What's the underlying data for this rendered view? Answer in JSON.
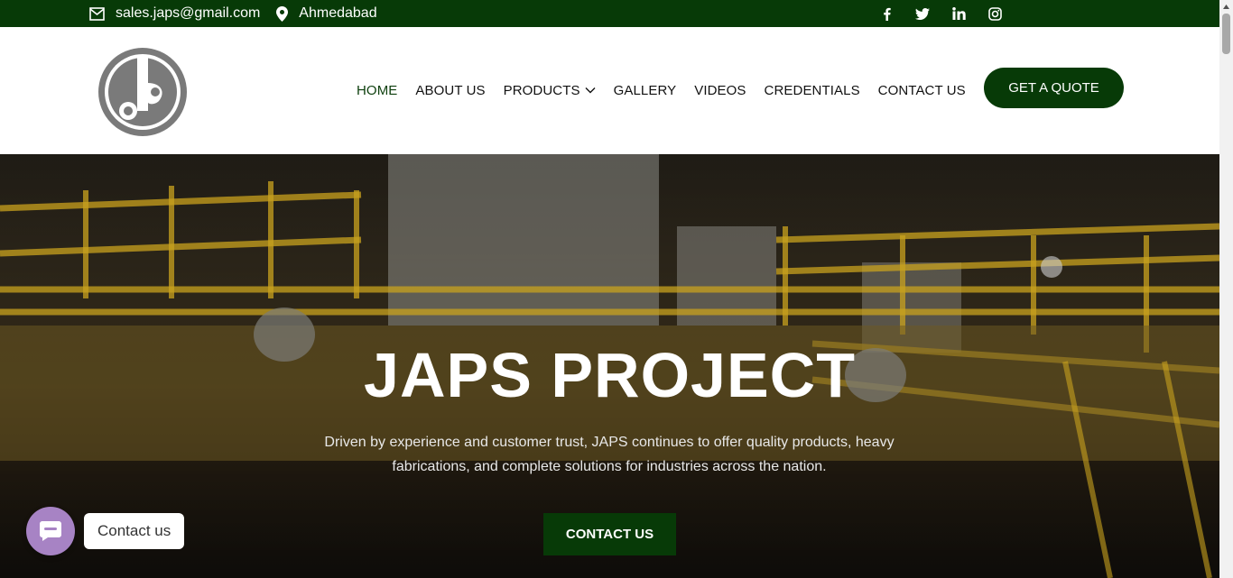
{
  "topbar": {
    "email": "sales.japs@gmail.com",
    "location": "Ahmedabad",
    "social": [
      "facebook-icon",
      "twitter-icon",
      "linkedin-icon",
      "instagram-icon"
    ]
  },
  "nav": {
    "items": [
      {
        "label": "HOME",
        "active": true
      },
      {
        "label": "ABOUT US"
      },
      {
        "label": "PRODUCTS",
        "dropdown": true
      },
      {
        "label": "GALLERY"
      },
      {
        "label": "VIDEOS"
      },
      {
        "label": "CREDENTIALS"
      },
      {
        "label": "CONTACT US"
      }
    ],
    "cta": "GET A QUOTE"
  },
  "hero": {
    "title": "JAPS PROJECT",
    "description": "Driven by experience and customer trust, JAPS continues to offer quality products, heavy fabrications, and complete solutions for industries across the nation.",
    "button": "CONTACT US"
  },
  "chat": {
    "label": "Contact us"
  },
  "colors": {
    "brand_green": "#073a07",
    "chat_purple": "#a783c4",
    "accent_yellow": "#c9a21e"
  }
}
